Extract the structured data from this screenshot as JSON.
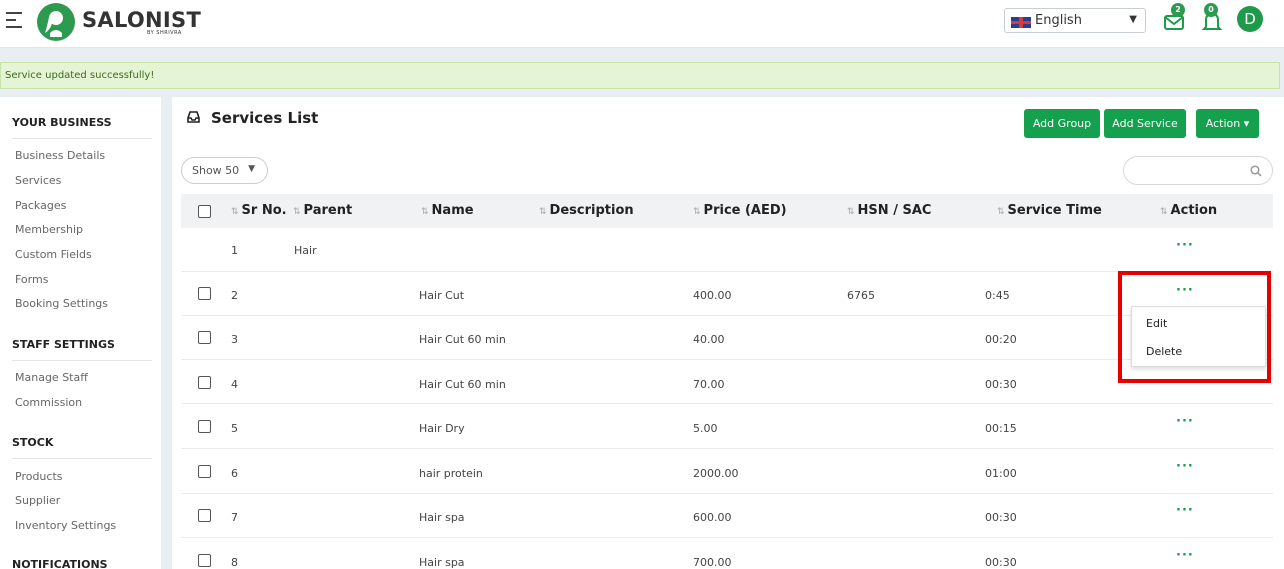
{
  "header": {
    "brand_name": "SALONIST",
    "brand_sub": "BY SHRIVRA",
    "language": "English",
    "messages_count": "2",
    "notifications_count": "0",
    "avatar_initial": "D"
  },
  "alert": {
    "text": "Service updated successfully!"
  },
  "sidebar": {
    "sections": [
      {
        "heading": "YOUR BUSINESS",
        "items": [
          "Business Details",
          "Services",
          "Packages",
          "Membership",
          "Custom Fields",
          "Forms",
          "Booking Settings"
        ]
      },
      {
        "heading": "STAFF SETTINGS",
        "items": [
          "Manage Staff",
          "Commission"
        ]
      },
      {
        "heading": "STOCK",
        "items": [
          "Products",
          "Supplier",
          "Inventory Settings"
        ]
      },
      {
        "heading": "NOTIFICATIONS",
        "items": []
      }
    ]
  },
  "panel": {
    "title": "Services List",
    "buttons": {
      "add_group": "Add Group",
      "add_service": "Add Service",
      "action": "Action ▾"
    },
    "show_select": "Show 50",
    "search_placeholder": ""
  },
  "table": {
    "columns": [
      "Sr No.",
      "Parent",
      "Name",
      "Description",
      "Price (AED)",
      "HSN / SAC",
      "Service Time",
      "Action"
    ],
    "rows": [
      {
        "sr": "1",
        "parent": "Hair",
        "name": "",
        "description": "",
        "price": "",
        "hsn": "",
        "time": "",
        "has_checkbox": false
      },
      {
        "sr": "2",
        "parent": "",
        "name": "Hair Cut",
        "description": "",
        "price": "400.00",
        "hsn": "6765",
        "time": "0:45",
        "has_checkbox": true
      },
      {
        "sr": "3",
        "parent": "",
        "name": "Hair Cut 60 min",
        "description": "",
        "price": "40.00",
        "hsn": "",
        "time": "00:20",
        "has_checkbox": true
      },
      {
        "sr": "4",
        "parent": "",
        "name": "Hair Cut 60 min",
        "description": "",
        "price": "70.00",
        "hsn": "",
        "time": "00:30",
        "has_checkbox": true
      },
      {
        "sr": "5",
        "parent": "",
        "name": "Hair Dry",
        "description": "",
        "price": "5.00",
        "hsn": "",
        "time": "00:15",
        "has_checkbox": true
      },
      {
        "sr": "6",
        "parent": "",
        "name": "hair protein",
        "description": "",
        "price": "2000.00",
        "hsn": "",
        "time": "01:00",
        "has_checkbox": true
      },
      {
        "sr": "7",
        "parent": "",
        "name": "Hair spa",
        "description": "",
        "price": "600.00",
        "hsn": "",
        "time": "00:30",
        "has_checkbox": true
      },
      {
        "sr": "8",
        "parent": "",
        "name": "Hair spa",
        "description": "",
        "price": "700.00",
        "hsn": "",
        "time": "00:30",
        "has_checkbox": true
      }
    ],
    "action_glyph": "···"
  },
  "dropdown": {
    "items": [
      "Edit",
      "Delete"
    ]
  },
  "colors": {
    "accent": "#14a04d",
    "highlight": "#e60000",
    "alert_bg": "#e6f4d6"
  }
}
